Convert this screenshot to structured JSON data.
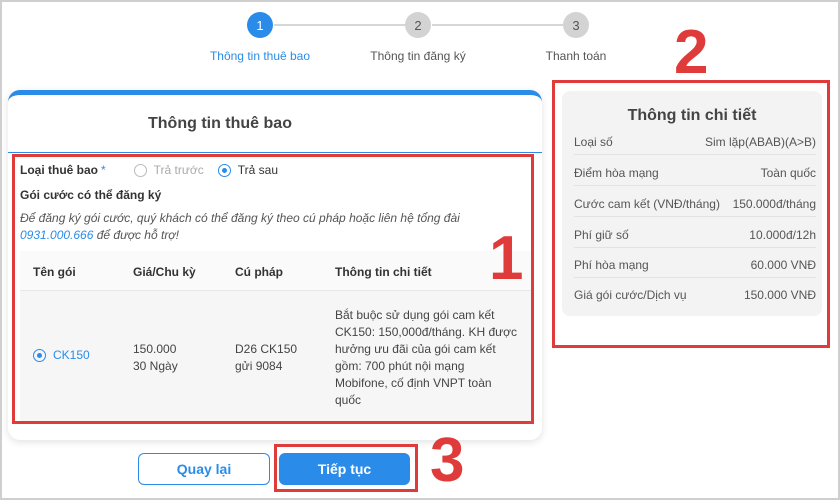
{
  "stepper": {
    "steps": [
      {
        "number": "1",
        "label": "Thông tin thuê bao"
      },
      {
        "number": "2",
        "label": "Thông tin đăng ký"
      },
      {
        "number": "3",
        "label": "Thanh toán"
      }
    ],
    "active_step": 1
  },
  "subscriber": {
    "title": "Thông tin thuê bao",
    "type_label": "Loại thuê bao",
    "required_mark": "*",
    "options": [
      {
        "label": "Trả trước",
        "selected": false,
        "disabled": true
      },
      {
        "label": "Trả sau",
        "selected": true,
        "disabled": false
      }
    ],
    "packages_heading": "Gói cước có thể đăng ký",
    "note_prefix": "Để đăng ký gói cước, quý khách có thể đăng ký theo cú pháp hoặc liên hệ tổng đài",
    "note_phone": "0931.000.666",
    "note_suffix": "để được hỗ trợ!"
  },
  "table": {
    "headers": [
      "Tên gói",
      "Giá/Chu kỳ",
      "Cú pháp",
      "Thông tin chi tiết"
    ],
    "rows": [
      {
        "name": "CK150",
        "price": "150.000",
        "cycle": "30 Ngày",
        "syntax_line1": "D26 CK150",
        "syntax_line2": "gửi 9084",
        "detail": "Bắt buộc sử dụng gói cam kết CK150: 150,000đ/tháng. KH được hưởng ưu đãi của gói cam kết gồm: 700 phút nội mạng Mobifone, cố định VNPT toàn quốc"
      }
    ]
  },
  "details": {
    "title": "Thông tin chi tiết",
    "rows": [
      {
        "label": "Loại số",
        "value": "Sim lặp(ABAB)(A>B)"
      },
      {
        "label": "Điểm hòa mạng",
        "value": "Toàn quốc"
      },
      {
        "label": "Cước cam kết (VNĐ/tháng)",
        "value": "150.000đ/tháng"
      },
      {
        "label": "Phí giữ số",
        "value": "10.000đ/12h"
      },
      {
        "label": "Phí hòa mạng",
        "value": "60.000 VNĐ"
      },
      {
        "label": "Giá gói cước/Dịch vụ",
        "value": "150.000 VNĐ"
      }
    ]
  },
  "buttons": {
    "back": "Quay lại",
    "next": "Tiếp tục"
  },
  "annotations": {
    "one": "1",
    "two": "2",
    "three": "3"
  },
  "colors": {
    "accent": "#2a8ce8",
    "highlight": "#e03b3b"
  }
}
